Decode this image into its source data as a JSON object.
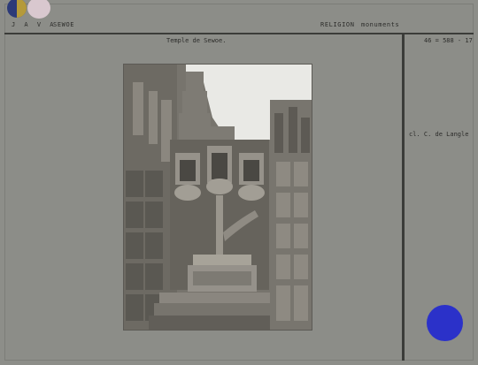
{
  "header": {
    "island": "J A V A",
    "place": "SEWOE",
    "category": "RELIGION",
    "subject": "monuments"
  },
  "caption": "Temple de Sewoe.",
  "reference": "46 = 588 - 17",
  "credit": "cl. C. de Langle",
  "photo": {
    "subject": "temple-carved-stone-niches-photo"
  },
  "colors": {
    "card": "#8c8d88",
    "rule": "#3b3c39",
    "blue_dot": "#2b31c9",
    "dot_navy": "#2c3a78",
    "dot_pink": "#d9c8cf"
  }
}
